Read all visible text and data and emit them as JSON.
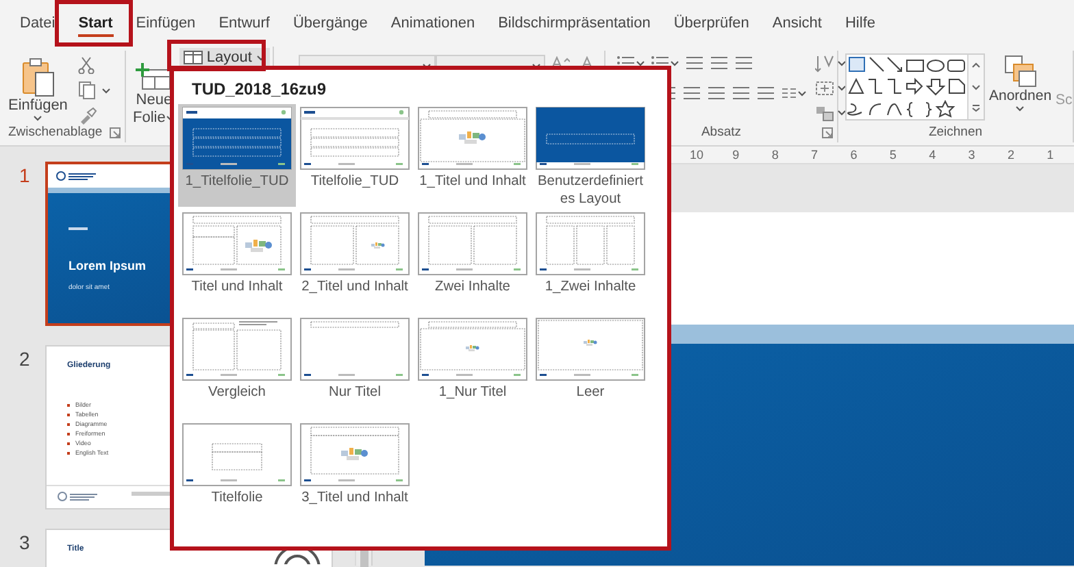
{
  "menu_tabs": [
    {
      "label": "Datei",
      "selected": false
    },
    {
      "label": "Start",
      "selected": true
    },
    {
      "label": "Einfügen",
      "selected": false
    },
    {
      "label": "Entwurf",
      "selected": false
    },
    {
      "label": "Übergänge",
      "selected": false
    },
    {
      "label": "Animationen",
      "selected": false
    },
    {
      "label": "Bildschirmpräsentation",
      "selected": false
    },
    {
      "label": "Überprüfen",
      "selected": false
    },
    {
      "label": "Ansicht",
      "selected": false
    },
    {
      "label": "Hilfe",
      "selected": false
    }
  ],
  "ribbon": {
    "paste_label": "Einfügen",
    "new_slide_label": [
      "Neue",
      "Folie"
    ],
    "layout_label": "Layout",
    "arrange_label": "Anordnen",
    "quick_styles_label": "Sc",
    "clipboard_group": "Zwischenablage",
    "paragraph_group": "Absatz",
    "drawing_group": "Zeichnen"
  },
  "ruler_marks": [
    "10",
    "9",
    "8",
    "7",
    "6",
    "5",
    "4",
    "3",
    "2",
    "1"
  ],
  "slides": [
    {
      "number": "1",
      "selected": true,
      "kind": "title",
      "title": "Lorem Ipsum",
      "subtitle": "dolor sit amet"
    },
    {
      "number": "2",
      "selected": false,
      "kind": "outline",
      "title": "Gliederung",
      "bullets": [
        "Bilder",
        "Tabellen",
        "Diagramme",
        "Freiformen",
        "Video",
        "English Text"
      ]
    },
    {
      "number": "3",
      "selected": false,
      "kind": "plain",
      "title": "Title"
    }
  ],
  "layout_gallery": {
    "title": "TUD_2018_16zu9",
    "layouts": [
      {
        "name": "1_Titelfolie_TUD",
        "kind": "title-dark",
        "selected": true
      },
      {
        "name": "Titelfolie_TUD",
        "kind": "title-light",
        "selected": false
      },
      {
        "name": "1_Titel und Inhalt",
        "kind": "content",
        "selected": false
      },
      {
        "name": "Benutzerdefiniertes Layout",
        "kind": "custom-dark",
        "selected": false
      },
      {
        "name": "Titel und Inhalt",
        "kind": "title-content",
        "selected": false
      },
      {
        "name": "2_Titel und Inhalt",
        "kind": "two-content-img",
        "selected": false
      },
      {
        "name": "Zwei Inhalte",
        "kind": "two-content",
        "selected": false
      },
      {
        "name": "1_Zwei Inhalte",
        "kind": "three-content",
        "selected": false
      },
      {
        "name": "Vergleich",
        "kind": "comparison",
        "selected": false
      },
      {
        "name": "Nur Titel",
        "kind": "title-only",
        "selected": false
      },
      {
        "name": "1_Nur Titel",
        "kind": "title-only-img",
        "selected": false
      },
      {
        "name": "Leer",
        "kind": "blank-img",
        "selected": false
      },
      {
        "name": "Titelfolie",
        "kind": "title-slide",
        "selected": false
      },
      {
        "name": "3_Titel und Inhalt",
        "kind": "content-wide",
        "selected": false
      }
    ]
  }
}
